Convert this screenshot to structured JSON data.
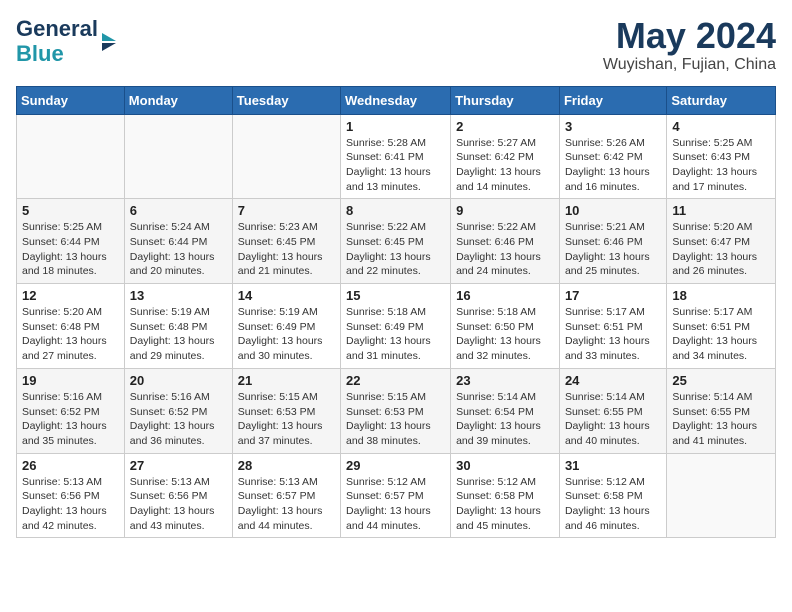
{
  "logo": {
    "line1": "General",
    "line2": "Blue"
  },
  "title": "May 2024",
  "location": "Wuyishan, Fujian, China",
  "days_of_week": [
    "Sunday",
    "Monday",
    "Tuesday",
    "Wednesday",
    "Thursday",
    "Friday",
    "Saturday"
  ],
  "weeks": [
    [
      {
        "day": "",
        "info": ""
      },
      {
        "day": "",
        "info": ""
      },
      {
        "day": "",
        "info": ""
      },
      {
        "day": "1",
        "info": "Sunrise: 5:28 AM\nSunset: 6:41 PM\nDaylight: 13 hours\nand 13 minutes."
      },
      {
        "day": "2",
        "info": "Sunrise: 5:27 AM\nSunset: 6:42 PM\nDaylight: 13 hours\nand 14 minutes."
      },
      {
        "day": "3",
        "info": "Sunrise: 5:26 AM\nSunset: 6:42 PM\nDaylight: 13 hours\nand 16 minutes."
      },
      {
        "day": "4",
        "info": "Sunrise: 5:25 AM\nSunset: 6:43 PM\nDaylight: 13 hours\nand 17 minutes."
      }
    ],
    [
      {
        "day": "5",
        "info": "Sunrise: 5:25 AM\nSunset: 6:44 PM\nDaylight: 13 hours\nand 18 minutes."
      },
      {
        "day": "6",
        "info": "Sunrise: 5:24 AM\nSunset: 6:44 PM\nDaylight: 13 hours\nand 20 minutes."
      },
      {
        "day": "7",
        "info": "Sunrise: 5:23 AM\nSunset: 6:45 PM\nDaylight: 13 hours\nand 21 minutes."
      },
      {
        "day": "8",
        "info": "Sunrise: 5:22 AM\nSunset: 6:45 PM\nDaylight: 13 hours\nand 22 minutes."
      },
      {
        "day": "9",
        "info": "Sunrise: 5:22 AM\nSunset: 6:46 PM\nDaylight: 13 hours\nand 24 minutes."
      },
      {
        "day": "10",
        "info": "Sunrise: 5:21 AM\nSunset: 6:46 PM\nDaylight: 13 hours\nand 25 minutes."
      },
      {
        "day": "11",
        "info": "Sunrise: 5:20 AM\nSunset: 6:47 PM\nDaylight: 13 hours\nand 26 minutes."
      }
    ],
    [
      {
        "day": "12",
        "info": "Sunrise: 5:20 AM\nSunset: 6:48 PM\nDaylight: 13 hours\nand 27 minutes."
      },
      {
        "day": "13",
        "info": "Sunrise: 5:19 AM\nSunset: 6:48 PM\nDaylight: 13 hours\nand 29 minutes."
      },
      {
        "day": "14",
        "info": "Sunrise: 5:19 AM\nSunset: 6:49 PM\nDaylight: 13 hours\nand 30 minutes."
      },
      {
        "day": "15",
        "info": "Sunrise: 5:18 AM\nSunset: 6:49 PM\nDaylight: 13 hours\nand 31 minutes."
      },
      {
        "day": "16",
        "info": "Sunrise: 5:18 AM\nSunset: 6:50 PM\nDaylight: 13 hours\nand 32 minutes."
      },
      {
        "day": "17",
        "info": "Sunrise: 5:17 AM\nSunset: 6:51 PM\nDaylight: 13 hours\nand 33 minutes."
      },
      {
        "day": "18",
        "info": "Sunrise: 5:17 AM\nSunset: 6:51 PM\nDaylight: 13 hours\nand 34 minutes."
      }
    ],
    [
      {
        "day": "19",
        "info": "Sunrise: 5:16 AM\nSunset: 6:52 PM\nDaylight: 13 hours\nand 35 minutes."
      },
      {
        "day": "20",
        "info": "Sunrise: 5:16 AM\nSunset: 6:52 PM\nDaylight: 13 hours\nand 36 minutes."
      },
      {
        "day": "21",
        "info": "Sunrise: 5:15 AM\nSunset: 6:53 PM\nDaylight: 13 hours\nand 37 minutes."
      },
      {
        "day": "22",
        "info": "Sunrise: 5:15 AM\nSunset: 6:53 PM\nDaylight: 13 hours\nand 38 minutes."
      },
      {
        "day": "23",
        "info": "Sunrise: 5:14 AM\nSunset: 6:54 PM\nDaylight: 13 hours\nand 39 minutes."
      },
      {
        "day": "24",
        "info": "Sunrise: 5:14 AM\nSunset: 6:55 PM\nDaylight: 13 hours\nand 40 minutes."
      },
      {
        "day": "25",
        "info": "Sunrise: 5:14 AM\nSunset: 6:55 PM\nDaylight: 13 hours\nand 41 minutes."
      }
    ],
    [
      {
        "day": "26",
        "info": "Sunrise: 5:13 AM\nSunset: 6:56 PM\nDaylight: 13 hours\nand 42 minutes."
      },
      {
        "day": "27",
        "info": "Sunrise: 5:13 AM\nSunset: 6:56 PM\nDaylight: 13 hours\nand 43 minutes."
      },
      {
        "day": "28",
        "info": "Sunrise: 5:13 AM\nSunset: 6:57 PM\nDaylight: 13 hours\nand 44 minutes."
      },
      {
        "day": "29",
        "info": "Sunrise: 5:12 AM\nSunset: 6:57 PM\nDaylight: 13 hours\nand 44 minutes."
      },
      {
        "day": "30",
        "info": "Sunrise: 5:12 AM\nSunset: 6:58 PM\nDaylight: 13 hours\nand 45 minutes."
      },
      {
        "day": "31",
        "info": "Sunrise: 5:12 AM\nSunset: 6:58 PM\nDaylight: 13 hours\nand 46 minutes."
      },
      {
        "day": "",
        "info": ""
      }
    ]
  ]
}
